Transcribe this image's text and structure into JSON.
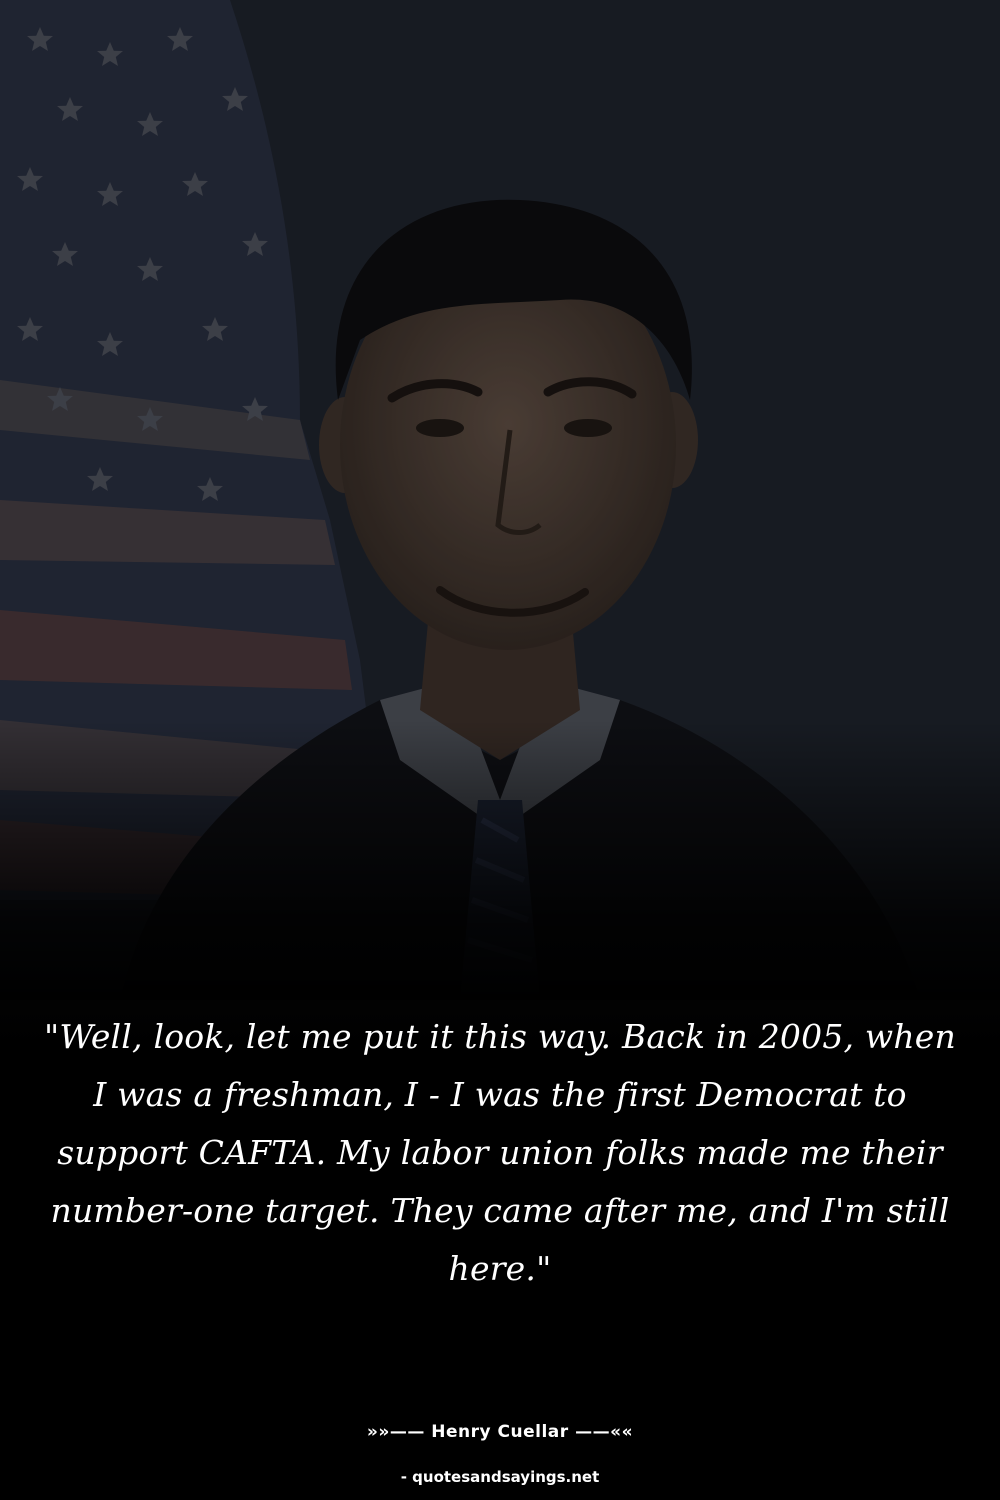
{
  "quote": {
    "text": "\"Well, look, let me put it this way. Back in 2005, when I was a freshman, I - I was the first Democrat to support CAFTA. My labor union folks made me their number-one target. They came after me, and I'm still here.\""
  },
  "author": {
    "line": "»»—— Henry Cuellar ——««"
  },
  "footer": {
    "source": "- quotesandsayings.net"
  },
  "colors": {
    "text": "#ffffff",
    "background": "#000000"
  }
}
